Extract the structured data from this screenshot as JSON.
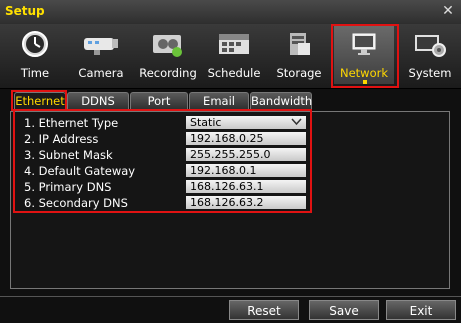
{
  "window": {
    "title": "Setup",
    "close_icon": "close-icon"
  },
  "toolbar": {
    "items": [
      {
        "label": "Time",
        "icon": "clock-icon"
      },
      {
        "label": "Camera",
        "icon": "camera-icon"
      },
      {
        "label": "Recording",
        "icon": "recording-icon"
      },
      {
        "label": "Schedule",
        "icon": "schedule-icon"
      },
      {
        "label": "Storage",
        "icon": "storage-icon"
      },
      {
        "label": "Network",
        "icon": "network-icon",
        "active": true
      },
      {
        "label": "System",
        "icon": "system-icon"
      }
    ]
  },
  "tabs": [
    {
      "label": "Ethernet",
      "active": true
    },
    {
      "label": "DDNS"
    },
    {
      "label": "Port"
    },
    {
      "label": "Email"
    },
    {
      "label": "Bandwidth"
    }
  ],
  "settings": [
    {
      "label": "1. Ethernet Type",
      "value": "Static",
      "type": "select"
    },
    {
      "label": "2. IP Address",
      "value": "192.168.0.25"
    },
    {
      "label": "3. Subnet Mask",
      "value": "255.255.255.0"
    },
    {
      "label": "4. Default Gateway",
      "value": "192.168.0.1"
    },
    {
      "label": "5. Primary DNS",
      "value": "168.126.63.1"
    },
    {
      "label": "6. Secondary DNS",
      "value": "168.126.63.2"
    }
  ],
  "footer": {
    "reset_label": "Reset",
    "save_label": "Save",
    "exit_label": "Exit"
  },
  "colors": {
    "highlight": "#e01212",
    "active_label": "#ffd800",
    "title": "#ffe000"
  }
}
